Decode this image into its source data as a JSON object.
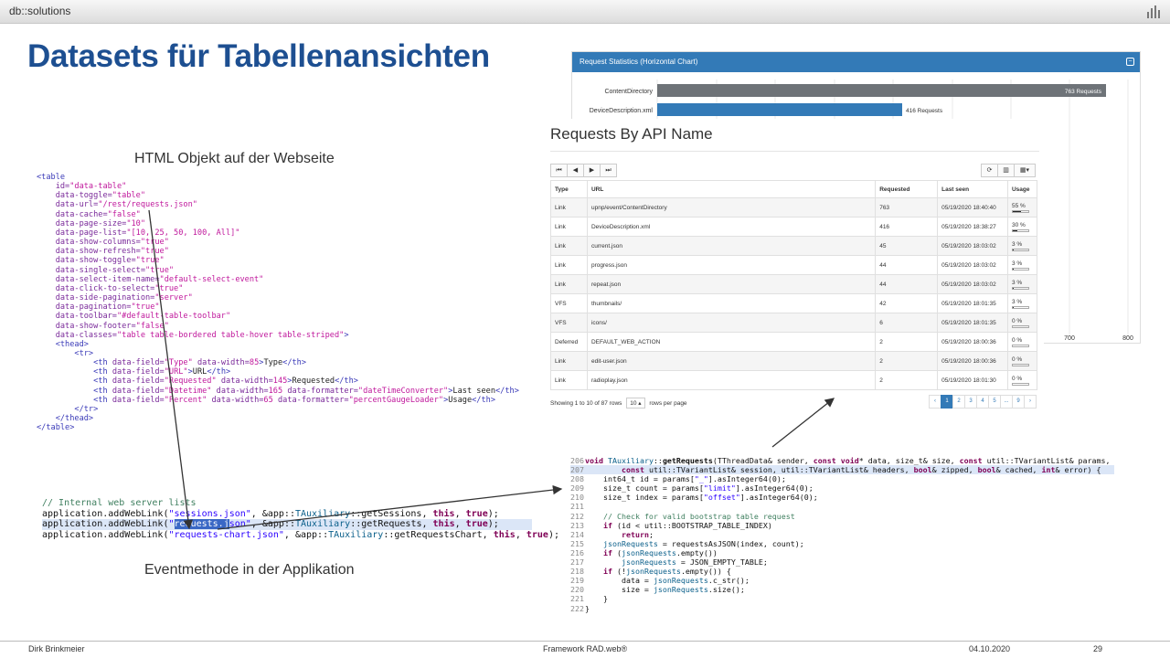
{
  "header": {
    "brand": "db::solutions",
    "logo_icon": "bars-logo-icon"
  },
  "slide": {
    "title": "Datasets für Tabellenansichten"
  },
  "captions": {
    "html_object": "HTML Objekt auf der Webseite",
    "event_method": "Eventmethode in der Applikation"
  },
  "chart_panel": {
    "title": "Request Statistics (Horizontal Chart)",
    "toggle_icon": "collapse-icon",
    "bar_labels": [
      "ContentDirectory",
      "DeviceDescription.xml"
    ],
    "bar_values": [
      "763 Requests",
      "416 Requests"
    ],
    "visible_ticks": [
      "700",
      "800"
    ]
  },
  "table_panel": {
    "title": "Requests By API Name",
    "columns": [
      "Type",
      "URL",
      "Requested",
      "Last seen",
      "Usage"
    ],
    "rows": [
      {
        "type": "Link",
        "url": "upnp/event/ContentDirectory",
        "requested": "763",
        "last_seen": "05/19/2020 18:40:40",
        "usage": "55 %",
        "pct": 55
      },
      {
        "type": "Link",
        "url": "DeviceDescription.xml",
        "requested": "416",
        "last_seen": "05/19/2020 18:38:27",
        "usage": "30 %",
        "pct": 30
      },
      {
        "type": "Link",
        "url": "current.json",
        "requested": "45",
        "last_seen": "05/19/2020 18:03:02",
        "usage": "3 %",
        "pct": 3
      },
      {
        "type": "Link",
        "url": "progress.json",
        "requested": "44",
        "last_seen": "05/19/2020 18:03:02",
        "usage": "3 %",
        "pct": 3
      },
      {
        "type": "Link",
        "url": "repeat.json",
        "requested": "44",
        "last_seen": "05/19/2020 18:03:02",
        "usage": "3 %",
        "pct": 3
      },
      {
        "type": "VFS",
        "url": "thumbnails/",
        "requested": "42",
        "last_seen": "05/19/2020 18:01:35",
        "usage": "3 %",
        "pct": 3
      },
      {
        "type": "VFS",
        "url": "icons/",
        "requested": "6",
        "last_seen": "05/19/2020 18:01:35",
        "usage": "0 %",
        "pct": 0
      },
      {
        "type": "Deferred",
        "url": "DEFAULT_WEB_ACTION",
        "requested": "2",
        "last_seen": "05/19/2020 18:00:36",
        "usage": "0 %",
        "pct": 0
      },
      {
        "type": "Link",
        "url": "edit-user.json",
        "requested": "2",
        "last_seen": "05/19/2020 18:00:36",
        "usage": "0 %",
        "pct": 0
      },
      {
        "type": "Link",
        "url": "radioplay.json",
        "requested": "2",
        "last_seen": "05/19/2020 18:01:30",
        "usage": "0 %",
        "pct": 0
      }
    ],
    "showing": "Showing 1 to 10 of 87 rows",
    "page_size": "10",
    "rows_per_page": "rows per page",
    "pages": [
      "‹",
      "1",
      "2",
      "3",
      "4",
      "5",
      "...",
      "9",
      "›"
    ],
    "active_page": "1",
    "pager_icons": [
      "first-page-icon",
      "prev-page-icon",
      "next-page-icon",
      "last-page-icon"
    ],
    "toolbar_icons": [
      "refresh-icon",
      "columns-icon",
      "grid-menu-icon"
    ]
  },
  "footer": {
    "author": "Dirk Brinkmeier",
    "product": "Framework RAD.web®",
    "date": "04.10.2020",
    "page": "29"
  }
}
